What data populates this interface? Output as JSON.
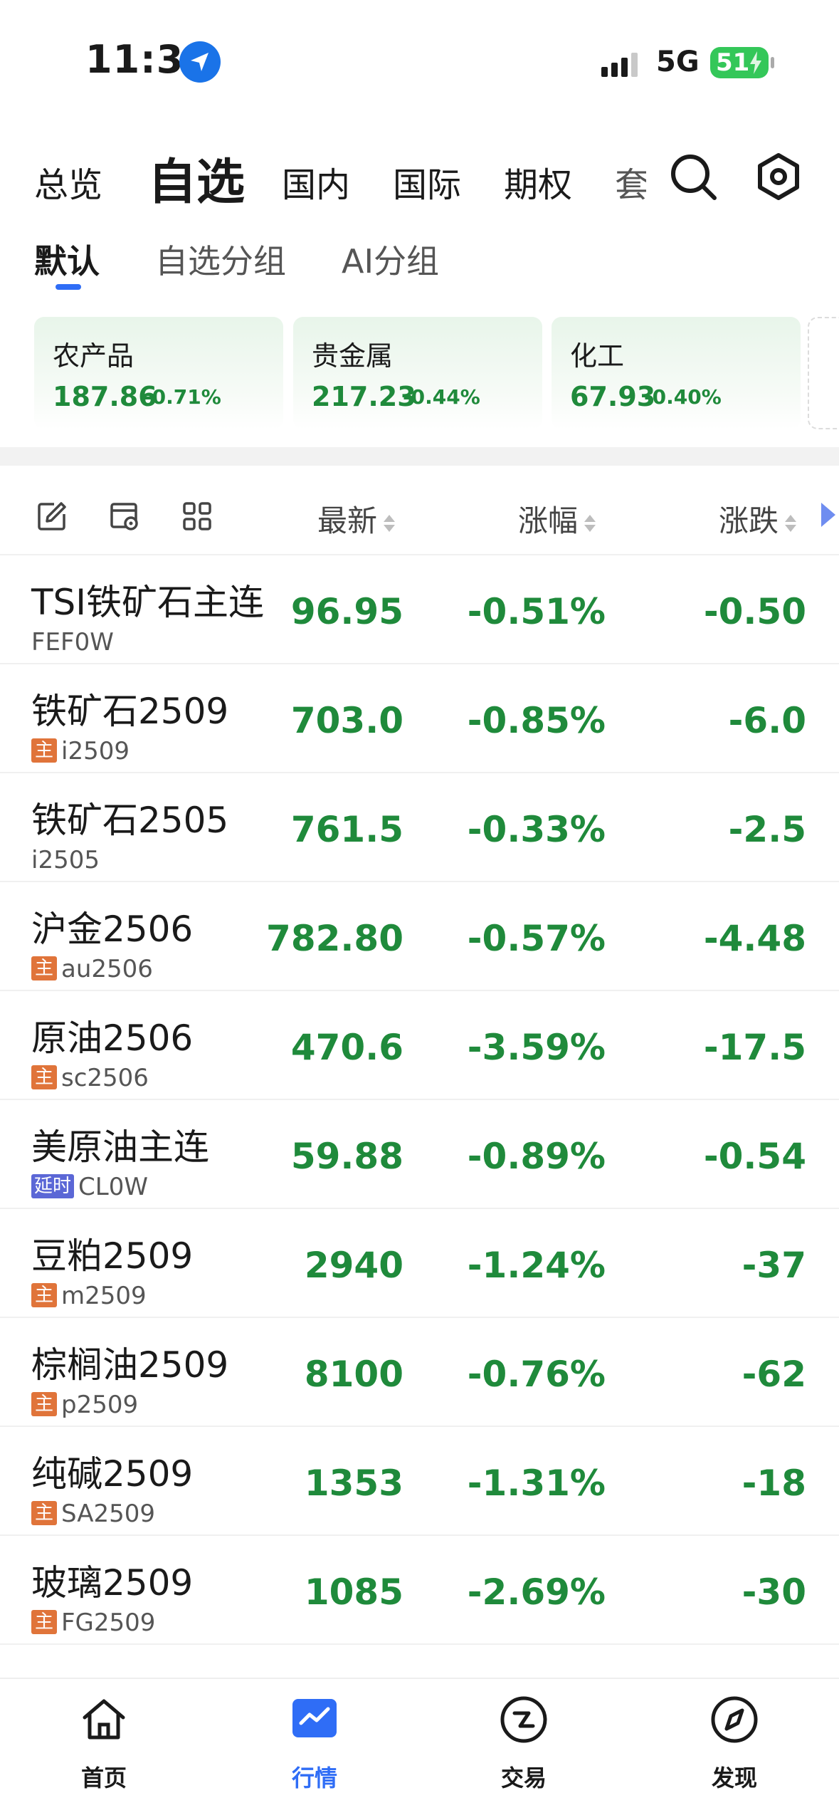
{
  "status": {
    "time": "11:38",
    "network": "5G",
    "battery": "51"
  },
  "top_tabs": {
    "items": [
      "总览",
      "自选",
      "国内",
      "国际",
      "期权",
      "套"
    ],
    "active_index": 1,
    "icons": [
      "search-icon",
      "settings-hexagon-icon"
    ]
  },
  "sub_tabs": {
    "items": [
      "默认",
      "自选分组",
      "AI分组"
    ],
    "active_index": 0
  },
  "sector_cards": [
    {
      "name": "农产品",
      "value": "187.86",
      "change": "-0.71%"
    },
    {
      "name": "贵金属",
      "value": "217.23",
      "change": "-0.44%"
    },
    {
      "name": "化工",
      "value": "67.93",
      "change": "-0.40%"
    }
  ],
  "table": {
    "header_icons": [
      "edit-icon",
      "card-settings-icon",
      "grid-icon"
    ],
    "columns": [
      "最新",
      "涨幅",
      "涨跌"
    ],
    "rows": [
      {
        "name": "TSI铁矿石主连",
        "badge": "",
        "code": "FEF0W",
        "last": "96.95",
        "pct": "-0.51%",
        "chg": "-0.50"
      },
      {
        "name": "铁矿石2509",
        "badge": "主",
        "code": "i2509",
        "last": "703.0",
        "pct": "-0.85%",
        "chg": "-6.0"
      },
      {
        "name": "铁矿石2505",
        "badge": "",
        "code": "i2505",
        "last": "761.5",
        "pct": "-0.33%",
        "chg": "-2.5"
      },
      {
        "name": "沪金2506",
        "badge": "主",
        "code": "au2506",
        "last": "782.80",
        "pct": "-0.57%",
        "chg": "-4.48"
      },
      {
        "name": "原油2506",
        "badge": "主",
        "code": "sc2506",
        "last": "470.6",
        "pct": "-3.59%",
        "chg": "-17.5"
      },
      {
        "name": "美原油主连",
        "badge": "延时",
        "code": "CL0W",
        "last": "59.88",
        "pct": "-0.89%",
        "chg": "-0.54"
      },
      {
        "name": "豆粕2509",
        "badge": "主",
        "code": "m2509",
        "last": "2940",
        "pct": "-1.24%",
        "chg": "-37"
      },
      {
        "name": "棕榈油2509",
        "badge": "主",
        "code": "p2509",
        "last": "8100",
        "pct": "-0.76%",
        "chg": "-62"
      },
      {
        "name": "纯碱2509",
        "badge": "主",
        "code": "SA2509",
        "last": "1353",
        "pct": "-1.31%",
        "chg": "-18"
      },
      {
        "name": "玻璃2509",
        "badge": "主",
        "code": "FG2509",
        "last": "1085",
        "pct": "-2.69%",
        "chg": "-30"
      }
    ]
  },
  "bottom_nav": {
    "items": [
      {
        "label": "首页",
        "icon": "home-icon"
      },
      {
        "label": "行情",
        "icon": "market-chart-icon"
      },
      {
        "label": "交易",
        "icon": "trade-icon"
      },
      {
        "label": "发现",
        "icon": "compass-icon"
      }
    ],
    "active_index": 1
  },
  "colors": {
    "down_green": "#1f8a3b",
    "accent_blue": "#2f6df6",
    "badge_main": "#e0743a",
    "badge_delay": "#5b67d6"
  }
}
